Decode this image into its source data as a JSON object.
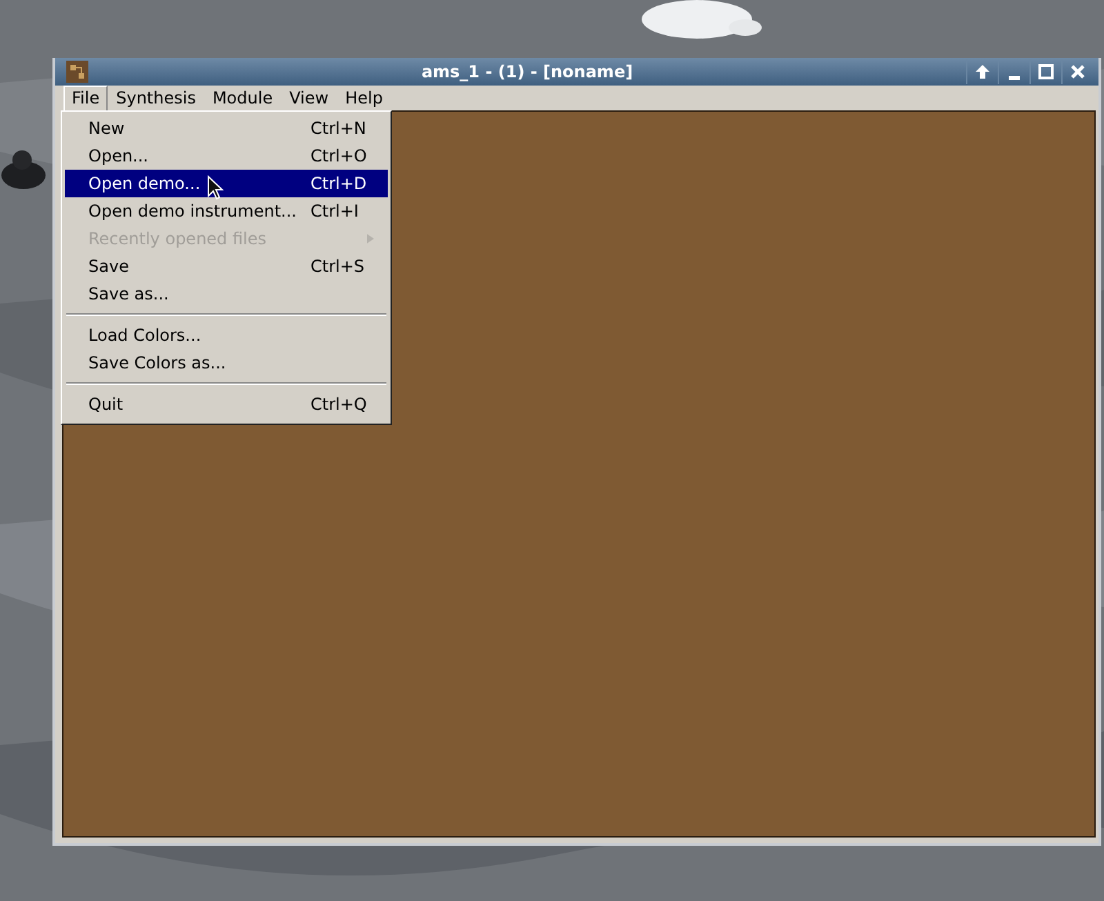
{
  "window": {
    "title": "ams_1 - (1) - [noname]"
  },
  "menubar": [
    {
      "label": "File",
      "selected": true
    },
    {
      "label": "Synthesis",
      "selected": false
    },
    {
      "label": "Module",
      "selected": false
    },
    {
      "label": "View",
      "selected": false
    },
    {
      "label": "Help",
      "selected": false
    }
  ],
  "file_menu": [
    {
      "kind": "item",
      "label": "New",
      "shortcut": "Ctrl+N",
      "selected": false,
      "disabled": false,
      "submenu": false
    },
    {
      "kind": "item",
      "label": "Open...",
      "shortcut": "Ctrl+O",
      "selected": false,
      "disabled": false,
      "submenu": false
    },
    {
      "kind": "item",
      "label": "Open demo...",
      "shortcut": "Ctrl+D",
      "selected": true,
      "disabled": false,
      "submenu": false
    },
    {
      "kind": "item",
      "label": "Open demo instrument...",
      "shortcut": "Ctrl+I",
      "selected": false,
      "disabled": false,
      "submenu": false
    },
    {
      "kind": "item",
      "label": "Recently opened files",
      "selected": false,
      "disabled": true,
      "submenu": true
    },
    {
      "kind": "item",
      "label": "Save",
      "shortcut": "Ctrl+S",
      "selected": false,
      "disabled": false,
      "submenu": false
    },
    {
      "kind": "item",
      "label": "Save as...",
      "selected": false,
      "disabled": false,
      "submenu": false
    },
    {
      "kind": "separator"
    },
    {
      "kind": "item",
      "label": "Load Colors...",
      "selected": false,
      "disabled": false,
      "submenu": false
    },
    {
      "kind": "item",
      "label": "Save Colors as...",
      "selected": false,
      "disabled": false,
      "submenu": false
    },
    {
      "kind": "separator"
    },
    {
      "kind": "item",
      "label": "Quit",
      "shortcut": "Ctrl+Q",
      "selected": false,
      "disabled": false,
      "submenu": false
    }
  ]
}
